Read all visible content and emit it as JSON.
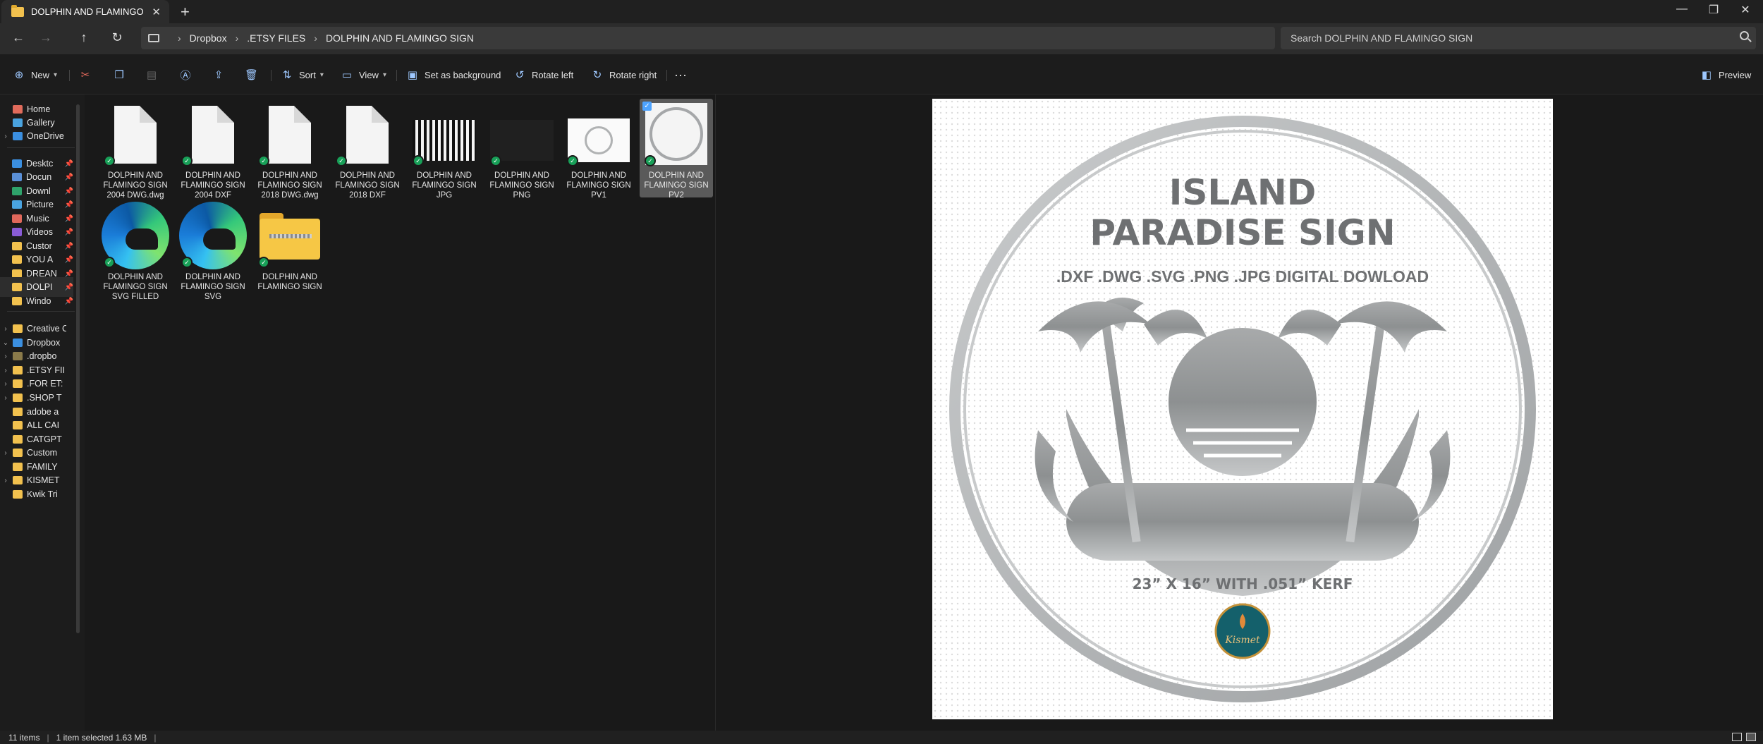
{
  "tab": {
    "title": "DOLPHIN AND FLAMINGO SIGN",
    "close": "✕",
    "add": "+"
  },
  "window": {
    "minimize": "—",
    "restore": "❐",
    "close": "✕"
  },
  "nav": {
    "back": "←",
    "forward": "→",
    "up": "↑",
    "refresh": "↻"
  },
  "breadcrumb": [
    "Dropbox",
    ".ETSY FILES",
    "DOLPHIN AND FLAMINGO SIGN"
  ],
  "breadcrumb_sep": "›",
  "search": {
    "placeholder": "Search DOLPHIN AND FLAMINGO SIGN"
  },
  "toolbar": {
    "new": "New",
    "sort": "Sort",
    "view": "View",
    "set_background": "Set as background",
    "rotate_left": "Rotate left",
    "rotate_right": "Rotate right",
    "more": "···",
    "preview": "Preview"
  },
  "sidebar": {
    "items": [
      {
        "label": "Home",
        "icon": "home-icon",
        "color": "#e06b5b"
      },
      {
        "label": "Gallery",
        "icon": "gallery-icon",
        "color": "#4aa3df"
      },
      {
        "label": "OneDrive",
        "icon": "cloud-icon",
        "color": "#3b8fe0"
      },
      {
        "label": "Desktc",
        "icon": "desktop-icon",
        "color": "#3b8fe0"
      },
      {
        "label": "Docun",
        "icon": "documents-icon",
        "color": "#5a8fd6"
      },
      {
        "label": "Downl",
        "icon": "downloads-icon",
        "color": "#2fa36b"
      },
      {
        "label": "Picture",
        "icon": "pictures-icon",
        "color": "#4aa3df"
      },
      {
        "label": "Music",
        "icon": "music-icon",
        "color": "#e0685b"
      },
      {
        "label": "Videos",
        "icon": "videos-icon",
        "color": "#8a5cd6"
      },
      {
        "label": "Custor",
        "icon": "folder-icon",
        "color": "#f2c14e"
      },
      {
        "label": "YOU A",
        "icon": "folder-icon",
        "color": "#f2c14e"
      },
      {
        "label": "DREAN",
        "icon": "folder-icon",
        "color": "#f2c14e"
      },
      {
        "label": "DOLPI",
        "icon": "folder-icon",
        "color": "#f2c14e"
      },
      {
        "label": "Windo",
        "icon": "folder-icon",
        "color": "#f2c14e"
      },
      {
        "label": "Creative C",
        "icon": "folder-icon",
        "color": "#f2c14e"
      },
      {
        "label": "Dropbox",
        "icon": "dropbox-icon",
        "color": "#3b8fe0"
      },
      {
        "label": ".dropbo",
        "icon": "folder-icon",
        "color": "#8a7a4a"
      },
      {
        "label": ".ETSY FII",
        "icon": "folder-icon",
        "color": "#f2c14e"
      },
      {
        "label": ".FOR ET:",
        "icon": "folder-icon",
        "color": "#f2c14e"
      },
      {
        "label": ".SHOP T",
        "icon": "folder-icon",
        "color": "#f2c14e"
      },
      {
        "label": "adobe a",
        "icon": "folder-icon",
        "color": "#f2c14e"
      },
      {
        "label": "ALL CAI",
        "icon": "folder-icon",
        "color": "#f2c14e"
      },
      {
        "label": "CATGPT",
        "icon": "folder-icon",
        "color": "#f2c14e"
      },
      {
        "label": "Custom",
        "icon": "folder-icon",
        "color": "#f2c14e"
      },
      {
        "label": "FAMILY",
        "icon": "folder-icon",
        "color": "#f2c14e"
      },
      {
        "label": "KISMET",
        "icon": "folder-icon",
        "color": "#f2c14e"
      },
      {
        "label": "Kwik Tri",
        "icon": "folder-icon",
        "color": "#f2c14e"
      }
    ]
  },
  "files": [
    {
      "name": "DOLPHIN AND FLAMINGO SIGN 2004 DWG.dwg",
      "kind": "document"
    },
    {
      "name": "DOLPHIN AND FLAMINGO SIGN 2004 DXF",
      "kind": "document"
    },
    {
      "name": "DOLPHIN AND FLAMINGO SIGN 2018 DWG.dwg",
      "kind": "document"
    },
    {
      "name": "DOLPHIN AND FLAMINGO SIGN 2018 DXF",
      "kind": "document"
    },
    {
      "name": "DOLPHIN AND FLAMINGO SIGN JPG",
      "kind": "image"
    },
    {
      "name": "DOLPHIN AND FLAMINGO SIGN PNG",
      "kind": "image"
    },
    {
      "name": "DOLPHIN AND FLAMINGO SIGN PV1",
      "kind": "image"
    },
    {
      "name": "DOLPHIN AND FLAMINGO SIGN PV2",
      "kind": "image",
      "selected": true
    },
    {
      "name": "DOLPHIN AND FLAMINGO SIGN SVG FILLED",
      "kind": "edge"
    },
    {
      "name": "DOLPHIN AND FLAMINGO SIGN SVG",
      "kind": "edge"
    },
    {
      "name": "DOLPHIN AND FLAMINGO SIGN",
      "kind": "zip"
    }
  ],
  "preview_image": {
    "title_line1": "ISLAND",
    "title_line2": "PARADISE SIGN",
    "formats": ".DXF .DWG .SVG .PNG .JPG DIGITAL DOWLOAD",
    "size": "23” X 16” WITH .051” KERF",
    "logo": "Kismet"
  },
  "status": {
    "count": "11 items",
    "selection": "1 item selected  1.63 MB"
  }
}
